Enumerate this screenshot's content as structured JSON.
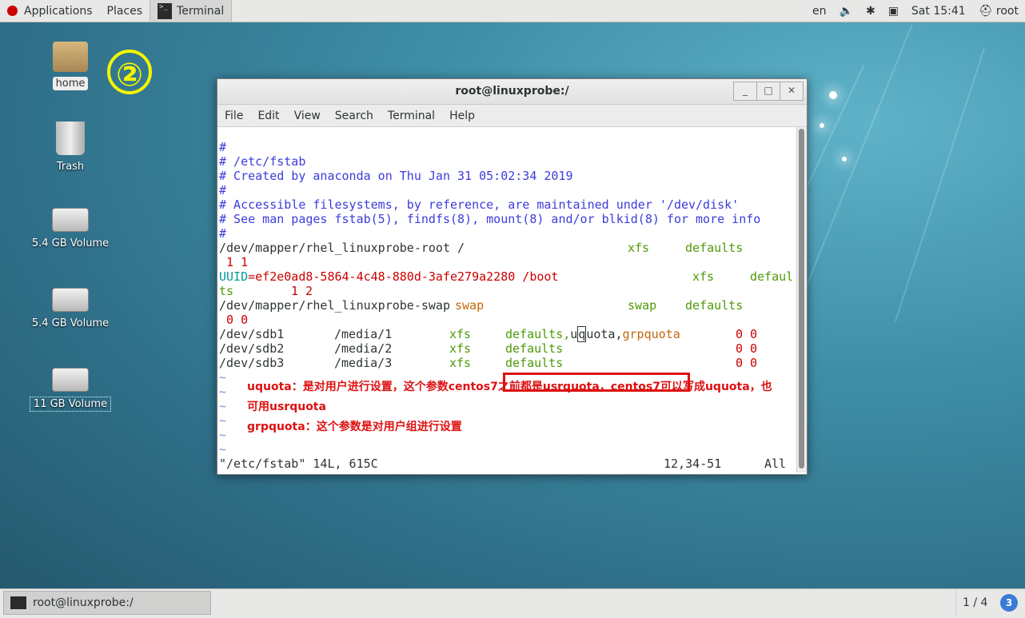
{
  "top_panel": {
    "applications": "Applications",
    "places": "Places",
    "active_app": "Terminal",
    "lang": "en",
    "clock": "Sat 15:41",
    "user": "root"
  },
  "desktop_icons": [
    {
      "label": "home",
      "icon": "folder-home-icon"
    },
    {
      "label": "Trash",
      "icon": "trash-icon"
    },
    {
      "label": "5.4 GB Volume",
      "icon": "drive-icon"
    },
    {
      "label": "5.4 GB Volume",
      "icon": "drive-icon"
    },
    {
      "label": "11 GB Volume",
      "icon": "drive-icon"
    }
  ],
  "annotation_number": "②",
  "window": {
    "title": "root@linuxprobe:/",
    "buttons": {
      "minimize": "_",
      "maximize": "□",
      "close": "✕"
    },
    "menu": [
      "File",
      "Edit",
      "View",
      "Search",
      "Terminal",
      "Help"
    ]
  },
  "terminal": {
    "l1": "#",
    "l2": "# /etc/fstab",
    "l3": "# Created by anaconda on Thu Jan 31 05:02:34 2019",
    "l4": "#",
    "l5": "# Accessible filesystems, by reference, are maintained under '/dev/disk'",
    "l6": "# See man pages fstab(5), findfs(8), mount(8) and/or blkid(8) for more info",
    "l7": "#",
    "root_dev": "/dev/mapper/rhel_linuxprobe-root /",
    "root_fs": "xfs",
    "root_opts": "defaults",
    "root_nums": " 1 1",
    "uuid_key": "UUID",
    "uuid_val": "=ef2e0ad8-5864-4c48-880d-3afe279a2280 /boot",
    "boot_fs": "xfs",
    "boot_opts_a": "defaul",
    "boot_opts_b": "ts",
    "boot_nums": "1 2",
    "swap_dev": "/dev/mapper/rhel_linuxprobe-swap",
    "swap_mp": "swap",
    "swap_fs": "swap",
    "swap_opts": "defaults",
    "swap_nums": " 0 0",
    "sdb1": {
      "dev": "/dev/sdb1",
      "mp": "/media/1",
      "fs": "xfs",
      "opts_a": "defaults,",
      "opts_b": "u",
      "opts_c": "q",
      "opts_d": "uota,",
      "opts_e": "grpquota",
      "nums": "0 0"
    },
    "sdb2": {
      "dev": "/dev/sdb2",
      "mp": "/media/2",
      "fs": "xfs",
      "opts": "defaults",
      "nums": "0 0"
    },
    "sdb3": {
      "dev": "/dev/sdb3",
      "mp": "/media/3",
      "fs": "xfs",
      "opts": "defaults",
      "nums": "0 0"
    },
    "tilde": "~",
    "status_left": "\"/etc/fstab\" 14L, 615C",
    "status_pos": "12,34-51",
    "status_right": "All"
  },
  "notes": {
    "uquota_line1": "uquota：是对用户进行设置，这个参数centos7之前都是usrquota，centos7可以写成uquota，也",
    "uquota_line2": "可用usrquota",
    "grpquota": "grpquota：这个参数是对用户组进行设置"
  },
  "bottom_panel": {
    "task_label": "root@linuxprobe:/",
    "workspace": "1 / 4",
    "badge": "3"
  }
}
